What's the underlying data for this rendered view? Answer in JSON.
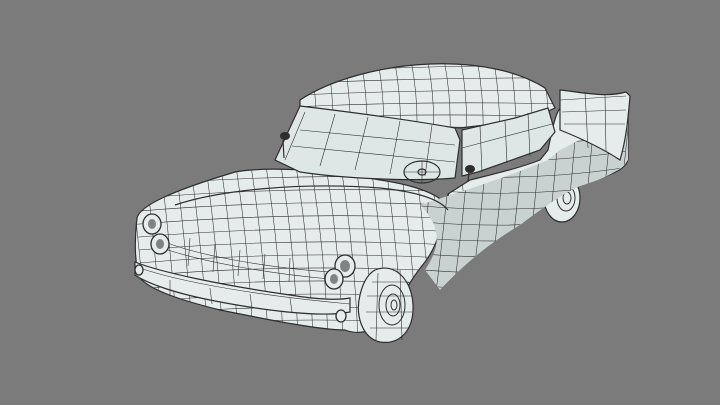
{
  "viewport": {
    "background_color": "#7b7b7b",
    "surface_color": "#e6ecec",
    "shadow_color": "#c9d1d1",
    "wire_color": "#2e2e2e",
    "glass_color": "#dfe6e6"
  },
  "model": {
    "render_style": "wireframe-on-shaded",
    "subject": "1950s sedan car"
  }
}
